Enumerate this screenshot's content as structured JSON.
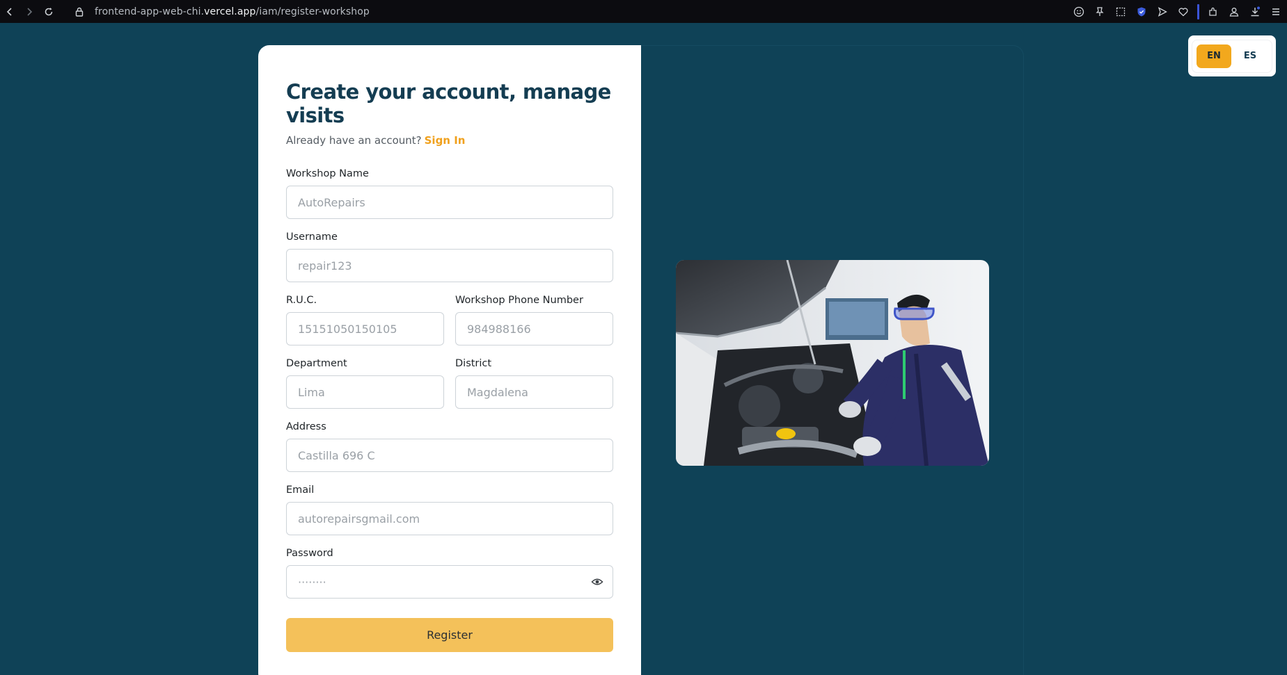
{
  "browser": {
    "url_prefix": "frontend-app-web-chi.",
    "url_host": "vercel.app",
    "url_path": "/iam/register-workshop"
  },
  "form": {
    "title": "Create your account, manage visits",
    "signin_prompt": "Already have an account?",
    "signin_link": "Sign In",
    "workshop_name": {
      "label": "Workshop Name",
      "placeholder": "AutoRepairs"
    },
    "username": {
      "label": "Username",
      "placeholder": "repair123"
    },
    "ruc": {
      "label": "R.U.C.",
      "placeholder": "15151050150105"
    },
    "phone": {
      "label": "Workshop Phone Number",
      "placeholder": "984988166"
    },
    "department": {
      "label": "Department",
      "placeholder": "Lima"
    },
    "district": {
      "label": "District",
      "placeholder": "Magdalena"
    },
    "address": {
      "label": "Address",
      "placeholder": "Castilla 696 C"
    },
    "email": {
      "label": "Email",
      "placeholder": "autorepairsgmail.com"
    },
    "password": {
      "label": "Password",
      "placeholder": "········"
    },
    "register_label": "Register"
  },
  "language": {
    "options": [
      "EN",
      "ES"
    ],
    "selected": "EN"
  },
  "colors": {
    "background": "#0f4257",
    "accent": "#f2a81d",
    "button": "#f4c15a",
    "title": "#143d52"
  }
}
